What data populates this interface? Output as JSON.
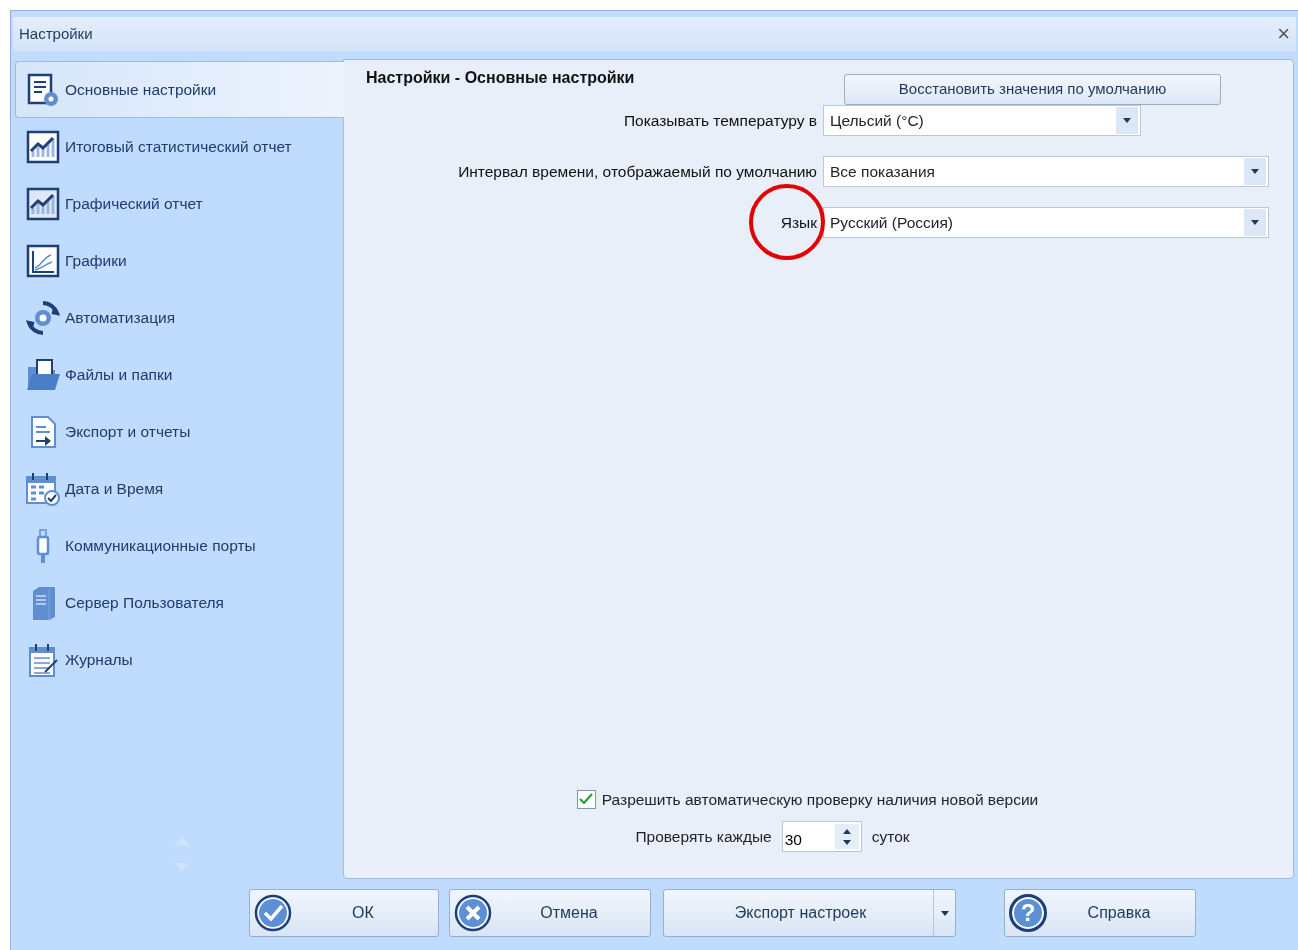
{
  "window": {
    "title": "Настройки",
    "close": "×"
  },
  "sidebar": {
    "items": [
      {
        "label": "Основные настройки",
        "selected": true
      },
      {
        "label": "Итоговый статистический отчет",
        "selected": false
      },
      {
        "label": "Графический отчет",
        "selected": false
      },
      {
        "label": "Графики",
        "selected": false
      },
      {
        "label": "Автоматизация",
        "selected": false
      },
      {
        "label": "Файлы и папки",
        "selected": false
      },
      {
        "label": "Экспорт и отчеты",
        "selected": false
      },
      {
        "label": "Дата и Время",
        "selected": false
      },
      {
        "label": "Коммуникационные порты",
        "selected": false
      },
      {
        "label": "Сервер Пользователя",
        "selected": false
      },
      {
        "label": "Журналы",
        "selected": false
      }
    ]
  },
  "panel": {
    "title": "Настройки - Основные настройки",
    "restore_button": "Восстановить значения по умолчанию",
    "settings": [
      {
        "label": "Показывать температуру в",
        "value": "Цельсий (°C)",
        "highlighted": false
      },
      {
        "label": "Интервал времени, отображаемый по умолчанию",
        "value": "Все показания",
        "highlighted": false
      },
      {
        "label": "Язык",
        "value": "Русский (Россия)",
        "highlighted": true
      }
    ],
    "auto_update": {
      "label": "Разрешить автоматическую проверку наличия новой версии",
      "checked": true
    },
    "interval": {
      "label": "Проверять каждые",
      "value": "30",
      "unit": "суток"
    }
  },
  "buttons": [
    {
      "label": "ОК",
      "kind": "ok"
    },
    {
      "label": "Отмена",
      "kind": "cancel"
    },
    {
      "label": "Экспорт настроек",
      "kind": "split"
    },
    {
      "label": "Справка",
      "kind": "help",
      "icon_text": "?"
    }
  ]
}
